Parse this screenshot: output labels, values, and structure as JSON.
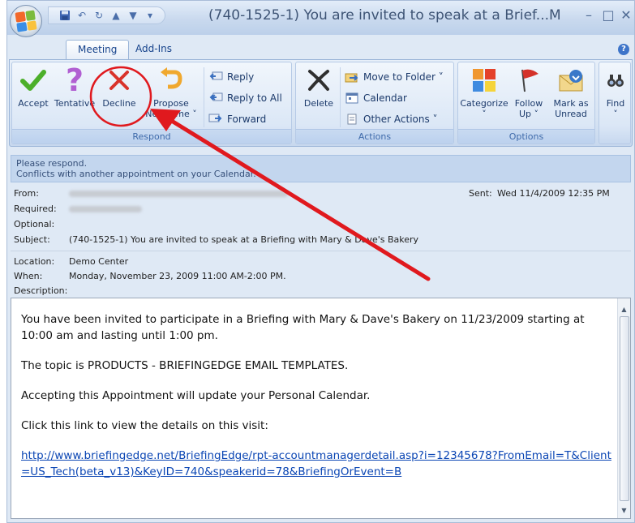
{
  "window": {
    "title": "(740-1525-1) You are invited to speak at a Brief...M",
    "minimize": "–",
    "maximize": "□",
    "close": "✕"
  },
  "tabs": [
    {
      "label": "Meeting"
    },
    {
      "label": "Add-Ins"
    }
  ],
  "help": "?",
  "ribbon": {
    "respond": {
      "label": "Respond",
      "accept": "Accept",
      "tentative": "Tentative",
      "decline": "Decline",
      "propose_line1": "Propose",
      "propose_line2": "New Time ˅",
      "reply": "Reply",
      "reply_all": "Reply to All",
      "forward": "Forward"
    },
    "actions": {
      "label": "Actions",
      "delete": "Delete",
      "move_to_folder": "Move to Folder ˅",
      "calendar": "Calendar",
      "other_actions": "Other Actions ˅"
    },
    "options": {
      "label": "Options",
      "categorize_line1": "Categorize",
      "categorize_line2": "˅",
      "follow_line1": "Follow",
      "follow_line2": "Up ˅",
      "mark_line1": "Mark as",
      "mark_line2": "Unread"
    },
    "find": {
      "label": "Find",
      "arrow": "˅"
    }
  },
  "infobar": {
    "line1": "Please respond.",
    "line2": "Conflicts with another appointment on your Calendar."
  },
  "header": {
    "from_label": "From:",
    "sent_label": "Sent:",
    "sent_value": "Wed 11/4/2009 12:35 PM",
    "required_label": "Required:",
    "optional_label": "Optional:",
    "subject_label": "Subject:",
    "subject_value": "(740-1525-1) You are invited to speak at a Briefing with Mary & Dave's Bakery",
    "location_label": "Location:",
    "location_value": "Demo Center",
    "when_label": "When:",
    "when_value": "Monday, November 23, 2009 11:00 AM-2:00 PM.",
    "description_label": "Description:"
  },
  "body": {
    "p1": "You have been invited to participate in a Briefing with Mary & Dave's Bakery on 11/23/2009 starting at 10:00 am and lasting until 1:00 pm.",
    "p2": "The topic is PRODUCTS - BRIEFINGEDGE EMAIL TEMPLATES.",
    "p3": "Accepting this Appointment will update your Personal Calendar.",
    "p4": "Click this link to view the details on this visit:",
    "link": "http://www.briefingedge.net/BriefingEdge/rpt-accountmanagerdetail.asp?i=12345678?FromEmail=T&Client=US_Tech(beta_v13)&KeyID=740&speakerid=78&BriefingOrEvent=B"
  },
  "colors": {
    "annotation_red": "#e0191e",
    "accept_green": "#4caf2a",
    "tentative_purple": "#b15fd2",
    "link_blue": "#0b46b4"
  }
}
